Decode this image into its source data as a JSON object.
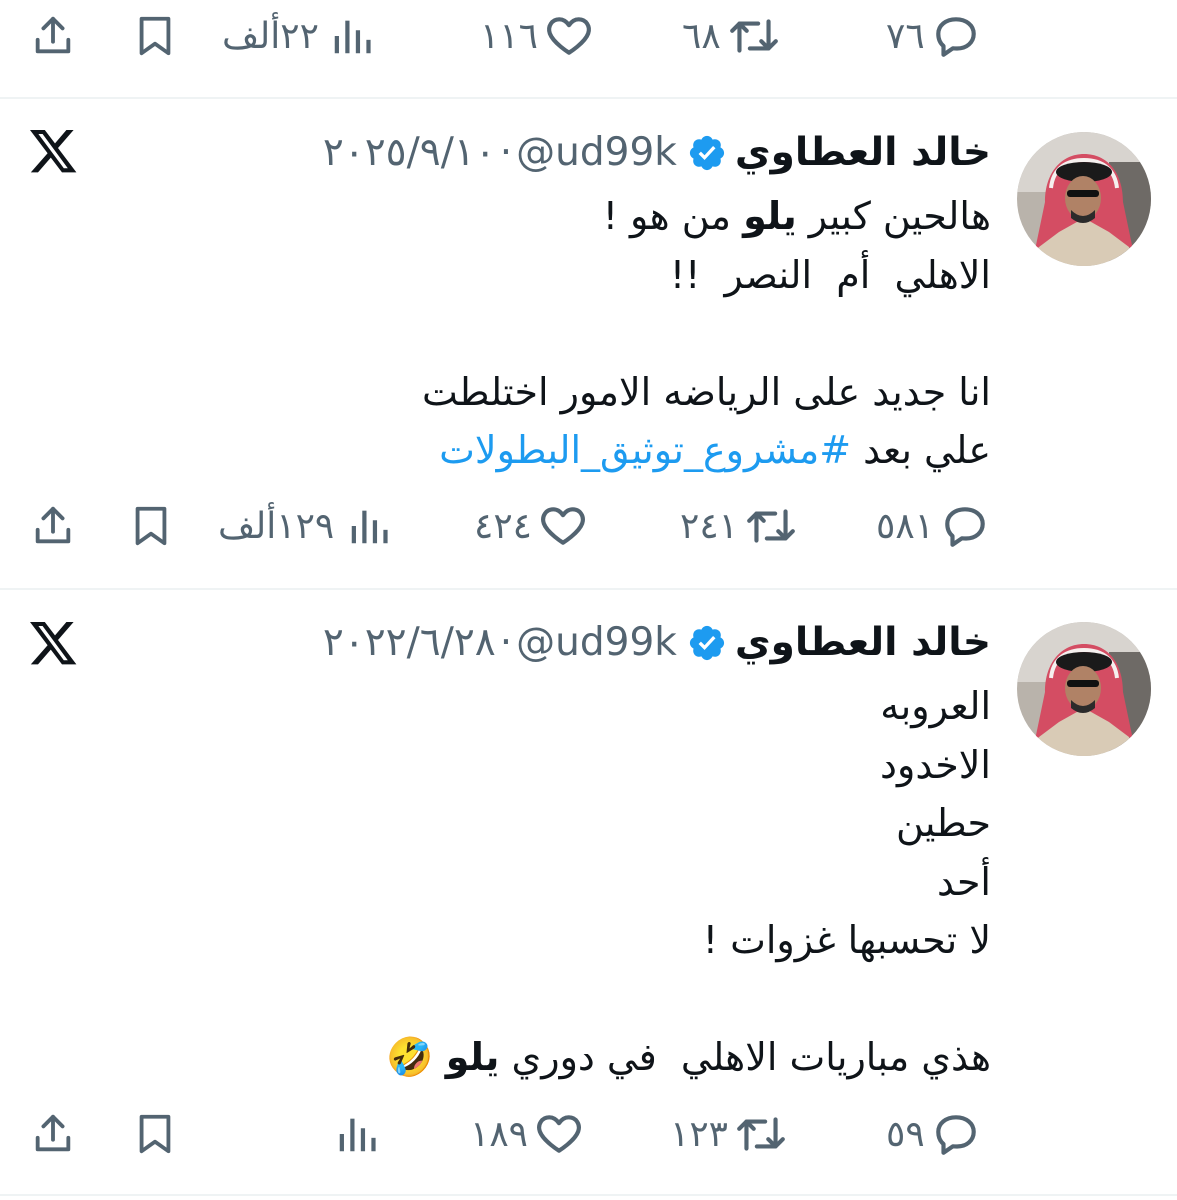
{
  "top_actions": {
    "reply_count": "٧٦",
    "retweet_count": "٦٨",
    "like_count": "١١٦",
    "views_count": "٢٢ألف"
  },
  "tweets": [
    {
      "author_name": "خالد العطاوي",
      "handle": "@ud99k",
      "separator": "·",
      "date": "٢٠٢٥/٩/١٠",
      "lines": [
        [
          "هالحين كبير ",
          "يلو",
          " من هو !"
        ],
        [
          "الاهلي  أم  النصر  !!"
        ],
        [
          ""
        ],
        [
          "انا جديد على الرياضه الامور اختلطت"
        ],
        [
          "علي بعد ",
          "#مشروع_توثيق_البطولات"
        ]
      ],
      "actions": {
        "reply_count": "٥٨١",
        "retweet_count": "٢٤١",
        "like_count": "٤٢٤",
        "views_count": "١٢٩ألف"
      }
    },
    {
      "author_name": "خالد العطاوي",
      "handle": "@ud99k",
      "separator": "·",
      "date": "٢٠٢٢/٦/٢٨",
      "lines": [
        [
          "العروبه"
        ],
        [
          "الاخدود"
        ],
        [
          "حطين"
        ],
        [
          "أحد"
        ],
        [
          "لا تحسبها غزوات !"
        ],
        [
          ""
        ],
        [
          "هذي مباريات الاهلي  في دوري ",
          "يلو",
          " 🤣"
        ]
      ],
      "actions": {
        "reply_count": "٥٩",
        "retweet_count": "١٢٣",
        "like_count": "١٨٩",
        "views_count": ""
      }
    }
  ],
  "colors": {
    "text": "#0f1419",
    "muted": "#536471",
    "link": "#1d9bf0",
    "verified": "#1d9bf0",
    "divider": "#eff3f4"
  },
  "icons": [
    "reply-icon",
    "retweet-icon",
    "like-icon",
    "views-icon",
    "bookmark-icon",
    "share-icon",
    "verified-icon",
    "x-logo-icon"
  ]
}
